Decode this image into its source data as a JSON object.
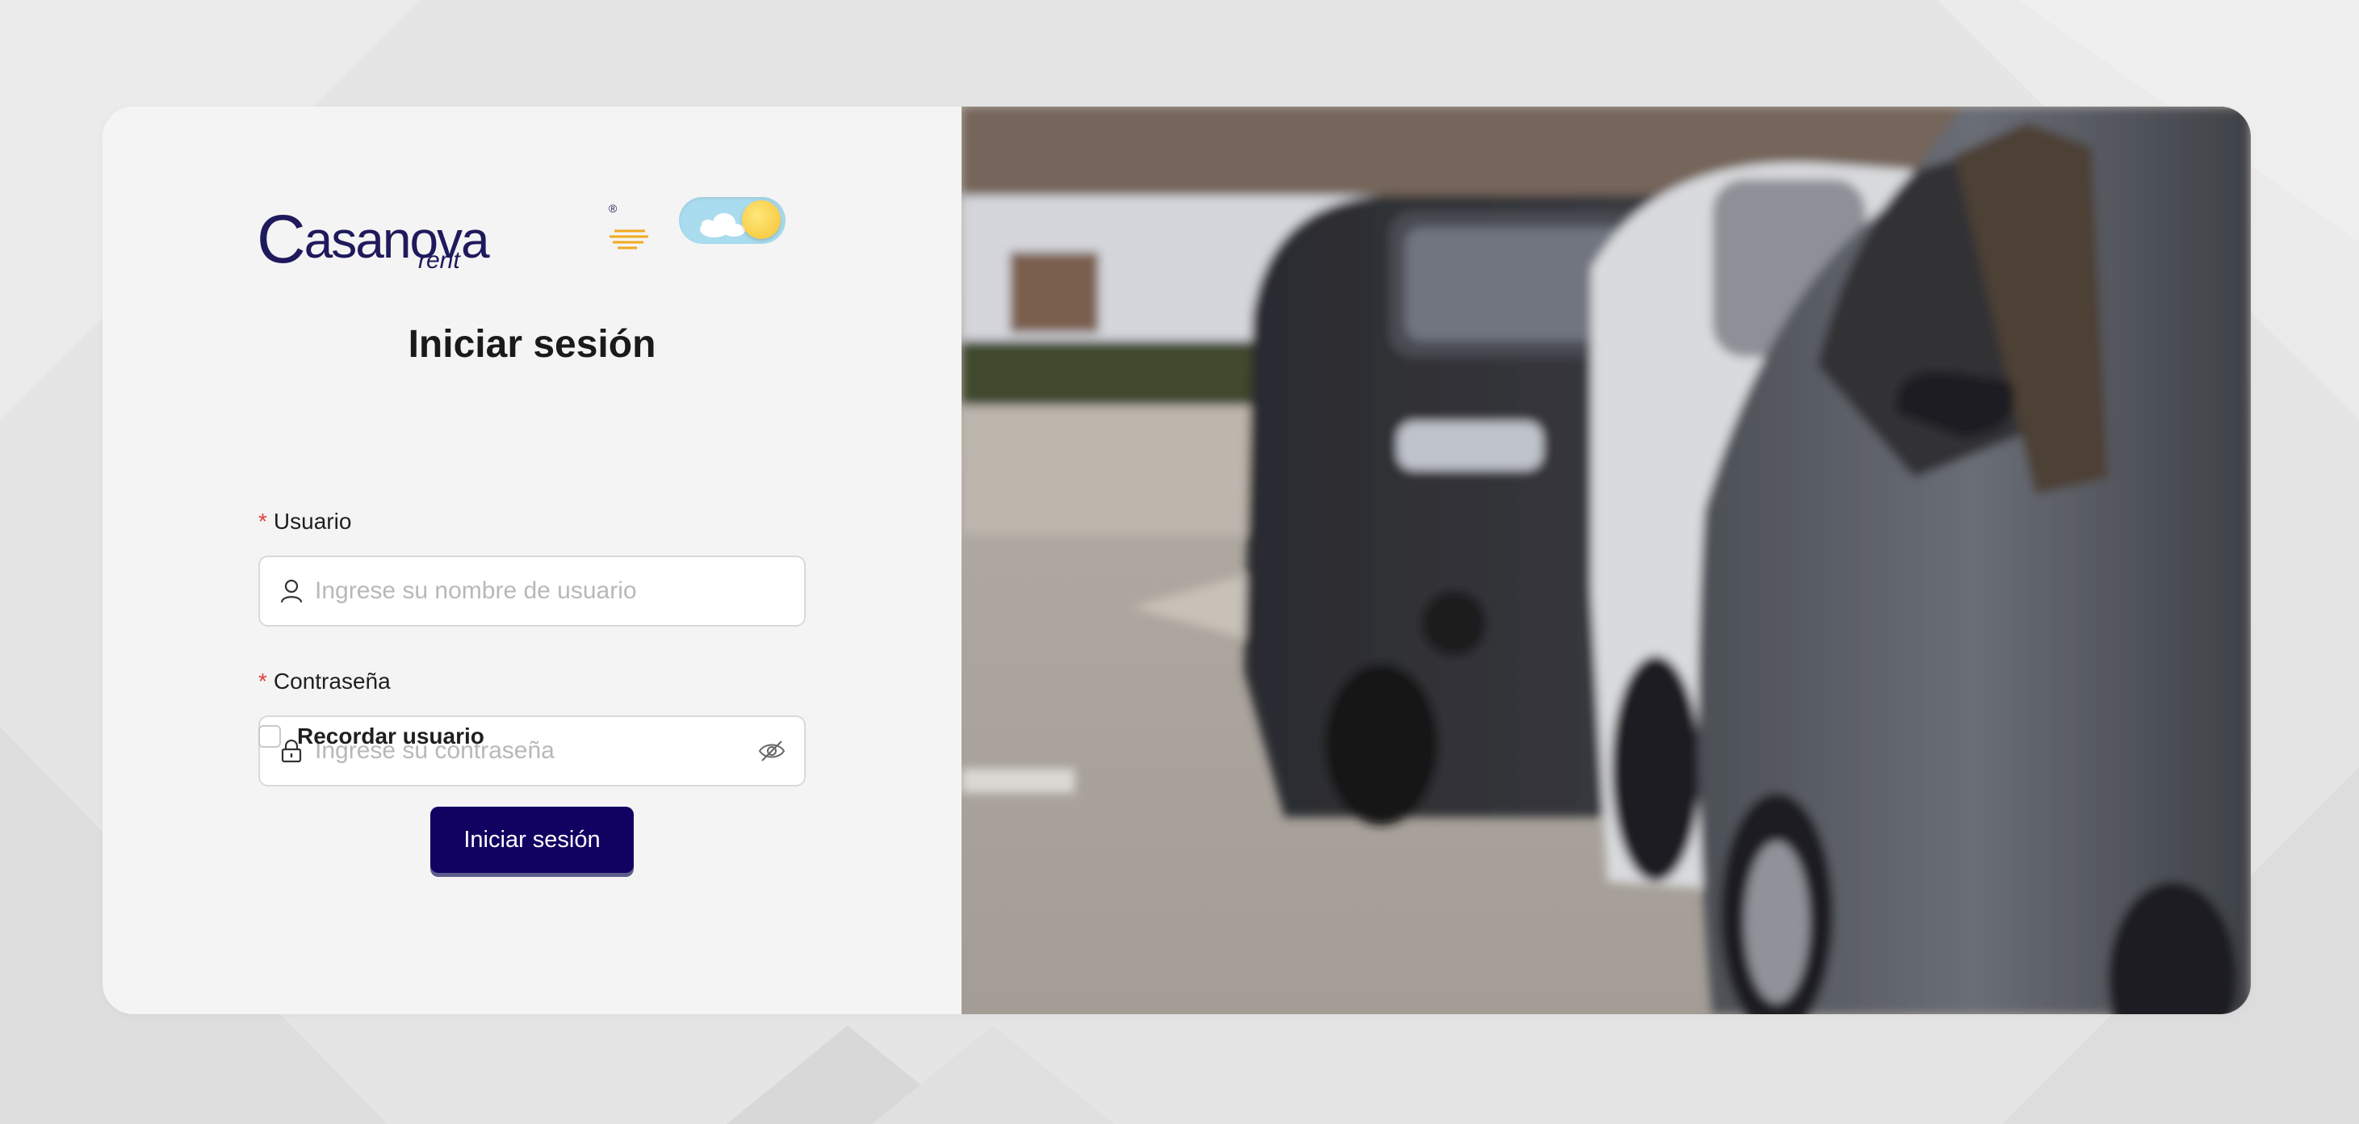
{
  "brand": {
    "name": "Casanova",
    "sub": "rent",
    "registered": "®",
    "colors": {
      "primary": "#1e1a5c",
      "accent": "#f2a91e"
    }
  },
  "theme_toggle": {
    "state": "light",
    "icon": "sun-icon",
    "cloud_icon": "cloud-icon"
  },
  "login": {
    "title": "Iniciar sesión",
    "username": {
      "required_mark": "*",
      "label": "Usuario",
      "placeholder": "Ingrese su nombre de usuario",
      "value": "",
      "icon": "user-icon"
    },
    "password": {
      "required_mark": "*",
      "label": "Contraseña",
      "placeholder": "Ingrese su contraseña",
      "value": "",
      "icon": "lock-icon",
      "toggle_icon": "eye-slash-icon"
    },
    "remember": {
      "label": "Recordar usuario",
      "checked": false
    },
    "submit_label": "Iniciar sesión",
    "button_color": "#110262"
  },
  "hero_image": {
    "subject": "parked-cars-photo"
  }
}
